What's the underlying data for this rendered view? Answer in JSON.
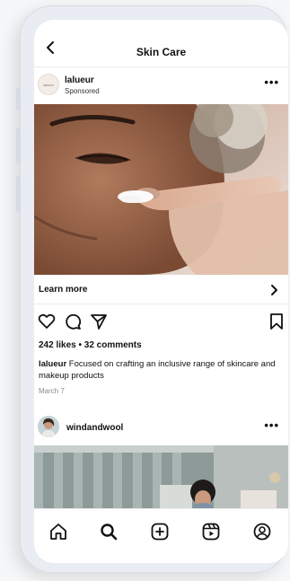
{
  "header": {
    "back_icon": "chevron-left-icon",
    "title": "Skin Care"
  },
  "post1": {
    "avatar_text": "lalueur",
    "username": "lalueur",
    "subtitle": "Sponsored",
    "more_label": "•••",
    "cta_label": "Learn more",
    "likes": "242 likes • 32 comments",
    "caption_user": "lalueur",
    "caption_text": "Focused on crafting an inclusive range of skincare and makeup products",
    "date": "March 7"
  },
  "post2": {
    "username": "windandwool",
    "more_label": "•••"
  },
  "tabbar": {
    "items": [
      "home-icon",
      "search-icon",
      "new-post-icon",
      "reels-icon",
      "profile-icon"
    ]
  },
  "colors": {
    "text": "#111111",
    "muted": "#8a8a8a",
    "divider": "#ececec",
    "frame": "#e9ecf2"
  }
}
